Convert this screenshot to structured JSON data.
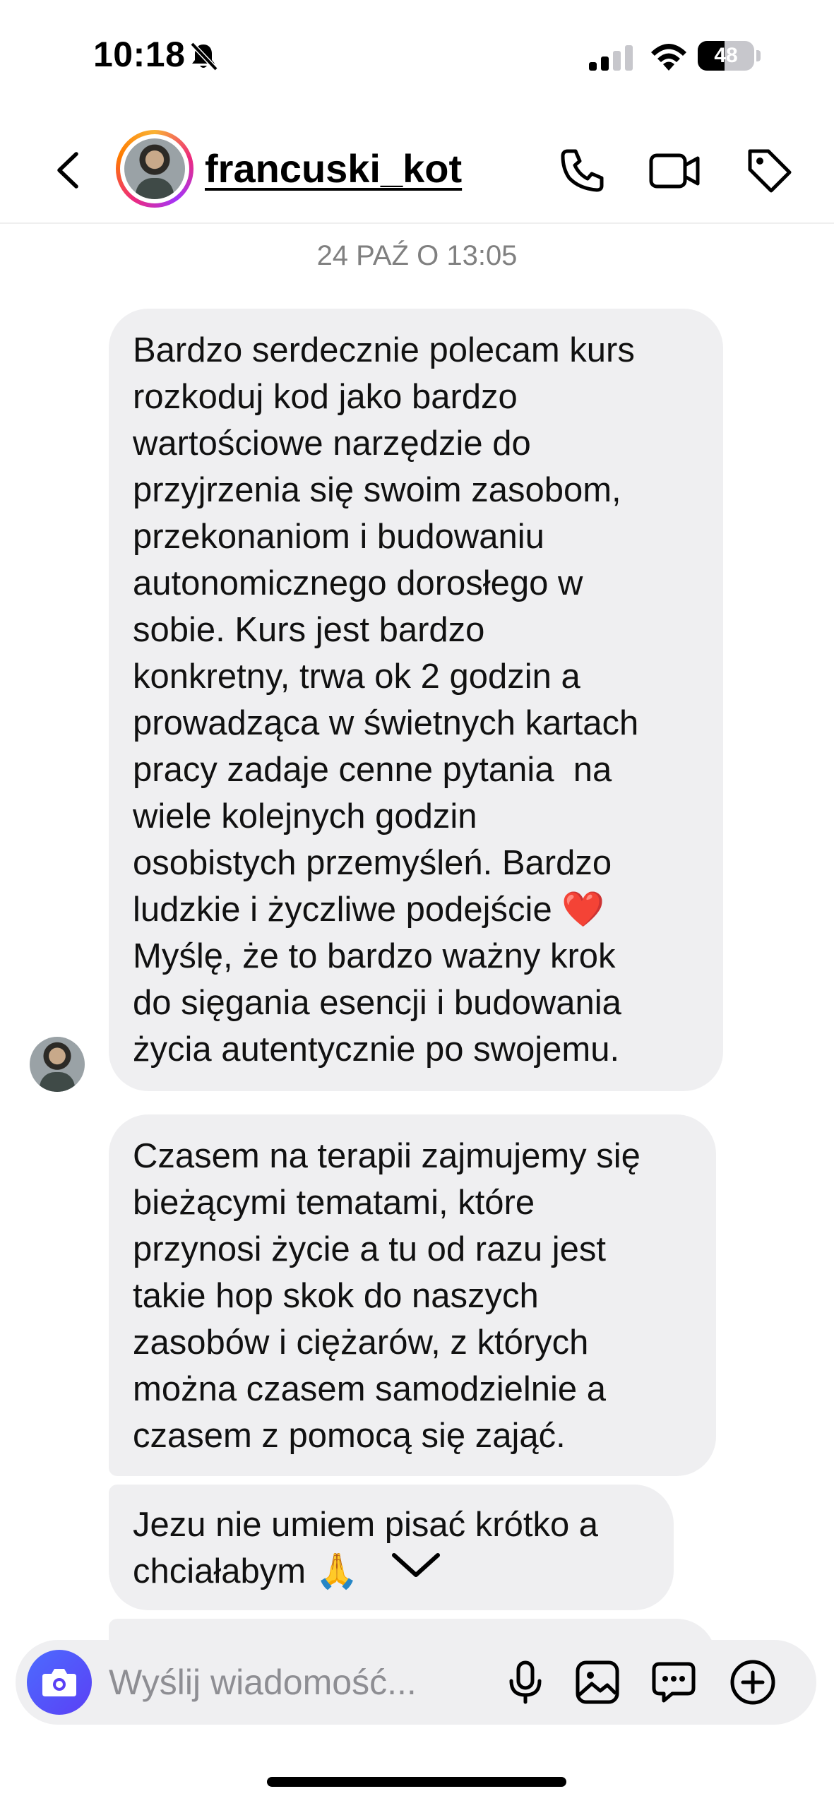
{
  "status_bar": {
    "time": "10:18",
    "battery_percent": "48",
    "battery_level": 0.48
  },
  "header": {
    "username": "francuski_kot",
    "icons": [
      "back-chevron-icon",
      "phone-icon",
      "video-camera-icon",
      "tag-icon"
    ]
  },
  "chat": {
    "date_label": "24 PAŹ O 13:05",
    "messages": [
      {
        "text": "Bardzo serdecznie polecam kurs\nrozkoduj kod jako bardzo\nwartościowe narzędzie do\nprzyjrzenia się swoim zasobom,\nprzekonaniom i budowaniu\nautonomicznego dorosłego w\nsobie. Kurs jest bardzo\nkonkretny, trwa ok 2 godzin a\nprowadząca w świetnych kartach\npracy zadaje cenne pytania  na\nwiele kolejnych godzin\nosobistych przemyśleń. Bardzo\nludzkie i życzliwe podejście ❤️\nMyślę, że to bardzo ważny krok\ndo sięgania esencji i budowania\nżycia autentycznie po swojemu."
      },
      {
        "text": "Czasem na terapii zajmujemy się\nbieżącymi tematami, które\nprzynosi życie a tu od razu jest\ntakie hop skok do naszych\nzasobów i ciężarów, z których\nmożna czasem samodzielnie a\nczasem z pomocą się zająć."
      },
      {
        "text": "Jezu nie umiem pisać krótko a\nchciałabym 🙏"
      },
      {
        "text": ""
      }
    ]
  },
  "composer": {
    "placeholder": "Wyślij wiadomość...",
    "value": "",
    "icons": [
      "camera-icon",
      "microphone-icon",
      "gallery-icon",
      "sticker-icon",
      "plus-icon"
    ]
  },
  "colors": {
    "bubble_background": "#efeff1",
    "camera_button": "#5b40f5",
    "secondary_text": "#808080"
  }
}
